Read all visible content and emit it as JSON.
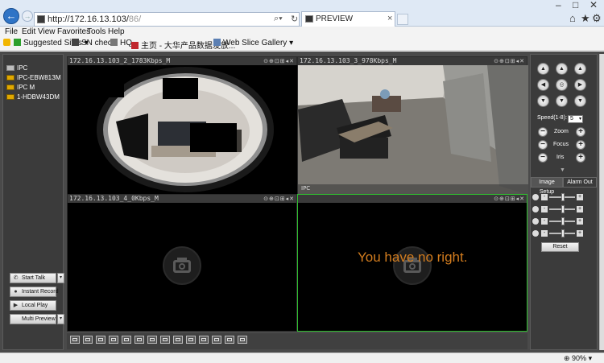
{
  "browser": {
    "address": "http://172.16.13.103/",
    "address_dim": "86/",
    "tab_title": "PREVIEW",
    "tab_close": "×",
    "menu": [
      "File",
      "Edit",
      "View",
      "Favorites",
      "Tools",
      "Help"
    ],
    "favorites": [
      "Suggested Sites ▾",
      "SN check",
      "HQ",
      "主页 - 大华产品数据发放...",
      "Web Slice Gallery ▾"
    ],
    "status_zoom": "90%",
    "window_controls": [
      "–",
      "□",
      "✕"
    ],
    "toolbar_icons": [
      "home-icon",
      "star-icon",
      "gear-icon"
    ]
  },
  "devices": [
    {
      "label": "IPC",
      "icon": "plain"
    },
    {
      "label": "IPC-EBW81ЗM",
      "icon": "folder"
    },
    {
      "label": "IPC          M",
      "icon": "folder"
    },
    {
      "label": "1-HDBW43DM",
      "icon": "folder"
    }
  ],
  "left_buttons": {
    "start_talk": "Start Talk",
    "instant_record": "Instant Record",
    "local_play": "Local Play",
    "multi_preview": "Multi Preview"
  },
  "panes": [
    {
      "title": "172.16.13.103_2_1783Kbps_M",
      "controls": "⊙⊕⊡⊞◂✕"
    },
    {
      "title": "172.16.13.103_3_978Kbps_M",
      "controls": "⊙⊕⊡⊞◂✕"
    },
    {
      "title": "172.16.13.103_4_0Kbps_M",
      "controls": "⊙⊕⊡⊞◂✕"
    },
    {
      "title": "",
      "controls": "⊙⊕⊡⊞◂✕"
    }
  ],
  "no_right_message": "You have no right.",
  "ptz": {
    "speed_label": "Speed(1-8):",
    "speed_value": "5",
    "zoom_label": "Zoom",
    "focus_label": "Focus",
    "iris_label": "Iris",
    "minus": "−",
    "plus": "+",
    "arrows": [
      "▲",
      "▲",
      "▲",
      "◀",
      "◎",
      "▶",
      "▼",
      "▼",
      "▼"
    ]
  },
  "image_tabs": [
    "Image Setup",
    "Alarm Out"
  ],
  "image_sliders": [
    {
      "icon": "brightness-icon",
      "level": 0.55
    },
    {
      "icon": "contrast-icon",
      "level": 0.55
    },
    {
      "icon": "saturation-icon",
      "level": 0.55
    },
    {
      "icon": "hue-icon",
      "level": 0.55
    }
  ],
  "reset_label": "Reset",
  "colors": {
    "selected_border": "#2fbf2f",
    "no_right_text": "#d27c1e",
    "folder": "#e0a800"
  }
}
